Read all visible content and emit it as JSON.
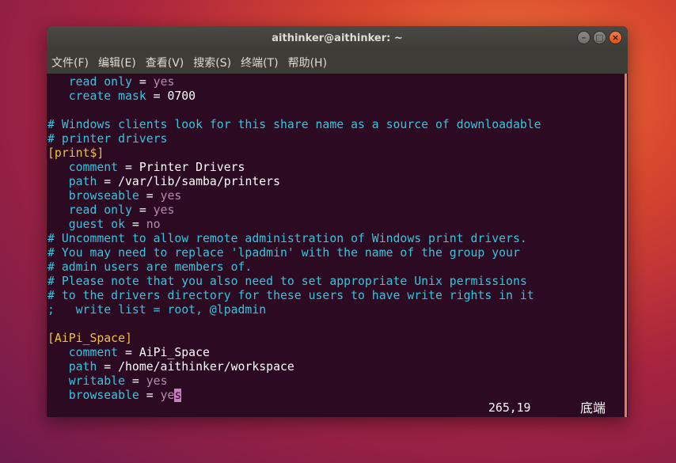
{
  "window": {
    "title": "aithinker@aithinker: ~"
  },
  "menu": [
    {
      "label": "文件(F)"
    },
    {
      "label": "编辑(E)"
    },
    {
      "label": "查看(V)"
    },
    {
      "label": "搜索(S)"
    },
    {
      "label": "终端(T)"
    },
    {
      "label": "帮助(H)"
    }
  ],
  "lines": [
    {
      "segs": [
        {
          "c": "t",
          "t": "   "
        },
        {
          "c": "k",
          "t": "read only"
        },
        {
          "c": "t",
          "t": " = "
        },
        {
          "c": "v",
          "t": "yes"
        }
      ]
    },
    {
      "segs": [
        {
          "c": "t",
          "t": "   "
        },
        {
          "c": "k",
          "t": "create mask"
        },
        {
          "c": "t",
          "t": " = 0700"
        }
      ]
    },
    {
      "segs": []
    },
    {
      "segs": [
        {
          "c": "c",
          "t": "# Windows clients look for this share name as a source of downloadable"
        }
      ]
    },
    {
      "segs": [
        {
          "c": "c",
          "t": "# printer drivers"
        }
      ]
    },
    {
      "segs": [
        {
          "c": "s",
          "t": "[print$]"
        }
      ]
    },
    {
      "segs": [
        {
          "c": "t",
          "t": "   "
        },
        {
          "c": "k",
          "t": "comment"
        },
        {
          "c": "t",
          "t": " = Printer Drivers"
        }
      ]
    },
    {
      "segs": [
        {
          "c": "t",
          "t": "   "
        },
        {
          "c": "k",
          "t": "path"
        },
        {
          "c": "t",
          "t": " = /var/lib/samba/printers"
        }
      ]
    },
    {
      "segs": [
        {
          "c": "t",
          "t": "   "
        },
        {
          "c": "k",
          "t": "browseable"
        },
        {
          "c": "t",
          "t": " = "
        },
        {
          "c": "v",
          "t": "yes"
        }
      ]
    },
    {
      "segs": [
        {
          "c": "t",
          "t": "   "
        },
        {
          "c": "k",
          "t": "read only"
        },
        {
          "c": "t",
          "t": " = "
        },
        {
          "c": "v",
          "t": "yes"
        }
      ]
    },
    {
      "segs": [
        {
          "c": "t",
          "t": "   "
        },
        {
          "c": "k",
          "t": "guest ok"
        },
        {
          "c": "t",
          "t": " = "
        },
        {
          "c": "v",
          "t": "no"
        }
      ]
    },
    {
      "segs": [
        {
          "c": "c",
          "t": "# Uncomment to allow remote administration of Windows print drivers."
        }
      ]
    },
    {
      "segs": [
        {
          "c": "c",
          "t": "# You may need to replace 'lpadmin' with the name of the group your"
        }
      ]
    },
    {
      "segs": [
        {
          "c": "c",
          "t": "# admin users are members of."
        }
      ]
    },
    {
      "segs": [
        {
          "c": "c",
          "t": "# Please note that you also need to set appropriate Unix permissions"
        }
      ]
    },
    {
      "segs": [
        {
          "c": "c",
          "t": "# to the drivers directory for these users to have write rights in it"
        }
      ]
    },
    {
      "segs": [
        {
          "c": "c",
          "t": ";   write list = root, @lpadmin"
        }
      ]
    },
    {
      "segs": []
    },
    {
      "segs": [
        {
          "c": "s",
          "t": "[AiPi_Space]"
        }
      ]
    },
    {
      "segs": [
        {
          "c": "t",
          "t": "   "
        },
        {
          "c": "k",
          "t": "comment"
        },
        {
          "c": "t",
          "t": " = AiPi_Space"
        }
      ]
    },
    {
      "segs": [
        {
          "c": "t",
          "t": "   "
        },
        {
          "c": "k",
          "t": "path"
        },
        {
          "c": "t",
          "t": " = /home/aithinker/workspace"
        }
      ]
    },
    {
      "segs": [
        {
          "c": "t",
          "t": "   "
        },
        {
          "c": "k",
          "t": "writable"
        },
        {
          "c": "t",
          "t": " = "
        },
        {
          "c": "v",
          "t": "yes"
        }
      ]
    },
    {
      "segs": [
        {
          "c": "t",
          "t": "   "
        },
        {
          "c": "k",
          "t": "browseable"
        },
        {
          "c": "t",
          "t": " = "
        },
        {
          "c": "v",
          "t": "ye"
        },
        {
          "c": "cursor",
          "t": "s"
        }
      ]
    }
  ],
  "status": {
    "position": "265,19",
    "label": "底端"
  },
  "colors": {
    "background": "#2c0a22",
    "keyword": "#35c6df",
    "value": "#b48ead",
    "section": "#f0c040",
    "cursor": "#c77fc0"
  }
}
